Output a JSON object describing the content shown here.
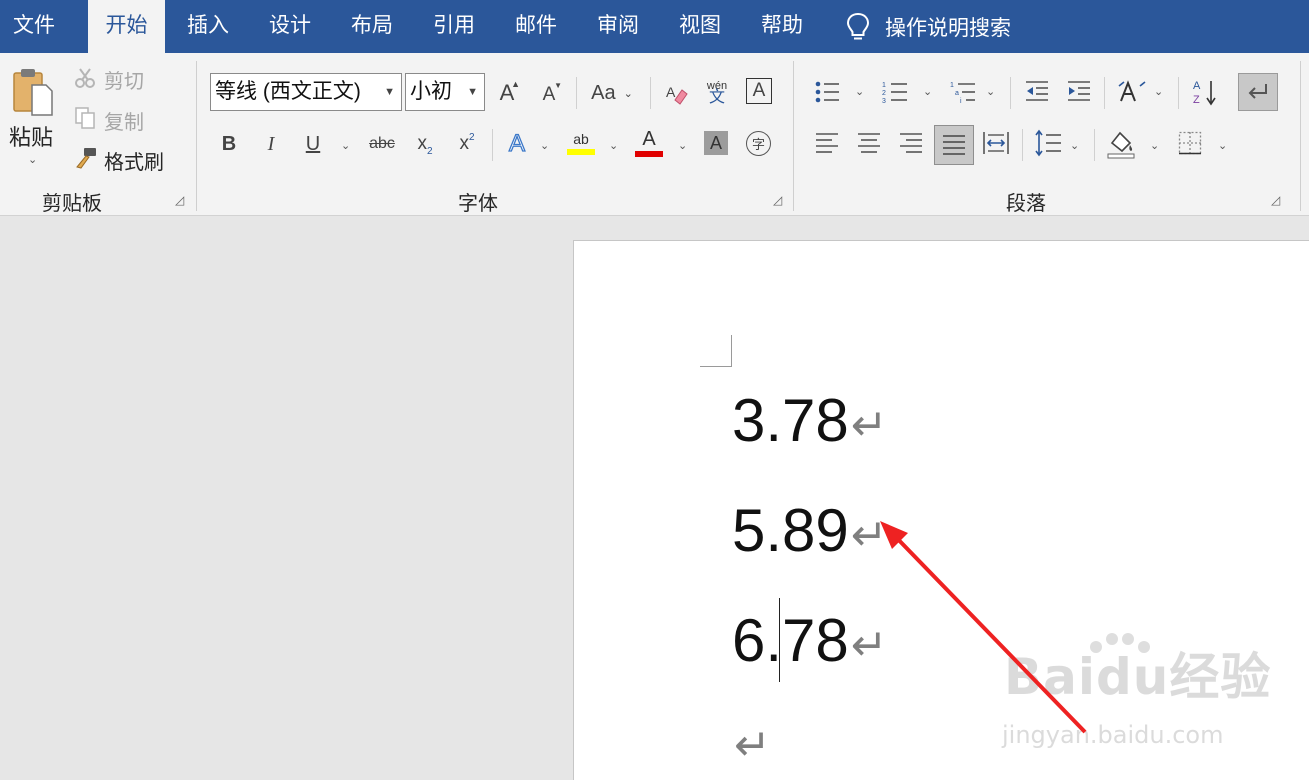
{
  "tabs": [
    {
      "label": "文件"
    },
    {
      "label": "开始"
    },
    {
      "label": "插入"
    },
    {
      "label": "设计"
    },
    {
      "label": "布局"
    },
    {
      "label": "引用"
    },
    {
      "label": "邮件"
    },
    {
      "label": "审阅"
    },
    {
      "label": "视图"
    },
    {
      "label": "帮助"
    }
  ],
  "active_tab": "开始",
  "tell_me": {
    "label": "操作说明搜索",
    "icon": "lightbulb-icon"
  },
  "clipboard": {
    "paste": "粘贴",
    "cut": "剪切",
    "copy": "复制",
    "format_painter": "格式刷",
    "group_label": "剪贴板"
  },
  "font": {
    "name": "等线 (西文正文)",
    "size": "小初",
    "group_label": "字体",
    "grow_glyph": "A",
    "shrink_glyph": "A",
    "case_glyph": "Aa",
    "phonetic_top": "wén",
    "phonetic_bottom": "文",
    "border_glyph": "A",
    "bold": "B",
    "italic": "I",
    "underline": "U",
    "strike": "abc",
    "subscript": "x",
    "sub_mark": "2",
    "superscript": "x",
    "sup_mark": "2",
    "effects_glyph": "A",
    "highlight_glyph": "ab",
    "fontcolor_glyph": "A",
    "shading_glyph": "A",
    "enclose_glyph": "字",
    "highlight_color": "#ffff00",
    "font_color": "#e00000"
  },
  "paragraph": {
    "group_label": "段落"
  },
  "document": {
    "lines": [
      "3.78",
      "5.89",
      "6.78",
      ""
    ],
    "pilcrow": "↵",
    "cursor_line": 2
  },
  "watermark": {
    "brand": "Baidu经验",
    "url": "jingyan.baidu.com"
  },
  "colors": {
    "tab_bar": "#2b579a",
    "ribbon": "#f3f3f3",
    "annotation_arrow": "#ee2222",
    "doc_background": "#e6e6e6"
  }
}
